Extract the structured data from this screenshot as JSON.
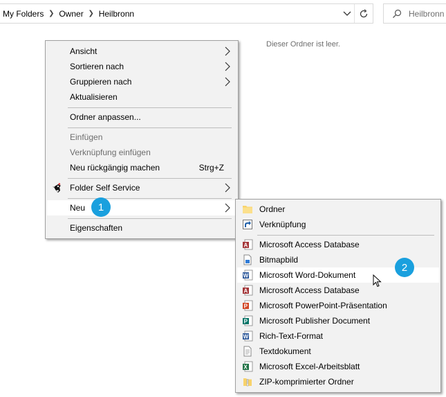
{
  "address_bar": {
    "breadcrumbs": [
      "My Folders",
      "Owner",
      "Heilbronn"
    ],
    "search_placeholder": "Heilbronn"
  },
  "content": {
    "empty_message": "Dieser Ordner ist leer."
  },
  "context_menu": {
    "items": [
      {
        "label": "Ansicht"
      },
      {
        "label": "Sortieren nach"
      },
      {
        "label": "Gruppieren nach"
      },
      {
        "label": "Aktualisieren"
      },
      {
        "label": "Ordner anpassen..."
      },
      {
        "label": "Einfügen"
      },
      {
        "label": "Verknüpfung einfügen"
      },
      {
        "label": "Neu rückgängig machen",
        "shortcut": "Strg+Z"
      },
      {
        "label": "Folder Self Service"
      },
      {
        "label": "Neu"
      },
      {
        "label": "Eigenschaften"
      }
    ]
  },
  "new_submenu": {
    "items": [
      {
        "label": "Ordner",
        "icon": "folder-icon"
      },
      {
        "label": "Verknüpfung",
        "icon": "shortcut-icon"
      },
      {
        "label": "Microsoft Access Database",
        "icon": "access-icon"
      },
      {
        "label": "Bitmapbild",
        "icon": "bitmap-icon"
      },
      {
        "label": "Microsoft Word-Dokument",
        "icon": "word-icon"
      },
      {
        "label": "Microsoft Access Database",
        "icon": "access-icon"
      },
      {
        "label": "Microsoft PowerPoint-Präsentation",
        "icon": "powerpoint-icon"
      },
      {
        "label": "Microsoft Publisher Document",
        "icon": "publisher-icon"
      },
      {
        "label": "Rich-Text-Format",
        "icon": "rtf-icon"
      },
      {
        "label": "Textdokument",
        "icon": "text-icon"
      },
      {
        "label": "Microsoft Excel-Arbeitsblatt",
        "icon": "excel-icon"
      },
      {
        "label": "ZIP-komprimierter Ordner",
        "icon": "zip-icon"
      }
    ]
  },
  "badges": {
    "step1": "1",
    "step2": "2"
  },
  "colors": {
    "menu_bg": "#f2f2f2",
    "highlight": "#ffffff",
    "badge": "#1aa0de",
    "disabled_text": "#6d6d6d"
  }
}
